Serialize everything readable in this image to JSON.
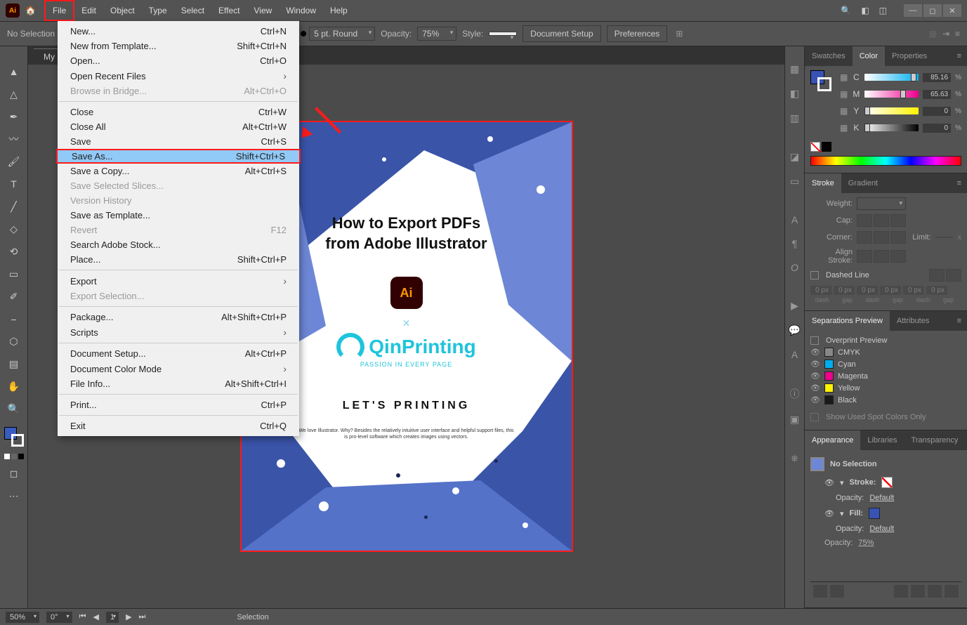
{
  "menubar": [
    "File",
    "Edit",
    "Object",
    "Type",
    "Select",
    "Effect",
    "View",
    "Window",
    "Help"
  ],
  "highlighted_menu_index": 0,
  "controlbar": {
    "selection": "No Selection",
    "stroke_label": "5 pt. Round",
    "opacity_label": "Opacity:",
    "opacity_value": "75%",
    "style_label": "Style:",
    "doc_setup": "Document Setup",
    "prefs": "Preferences"
  },
  "tab": "My bo",
  "dropdown": [
    {
      "label": "New...",
      "shortcut": "Ctrl+N"
    },
    {
      "label": "New from Template...",
      "shortcut": "Shift+Ctrl+N"
    },
    {
      "label": "Open...",
      "shortcut": "Ctrl+O"
    },
    {
      "label": "Open Recent Files",
      "sub": true
    },
    {
      "label": "Browse in Bridge...",
      "shortcut": "Alt+Ctrl+O",
      "disabled": true
    },
    {
      "sep": true
    },
    {
      "label": "Close",
      "shortcut": "Ctrl+W"
    },
    {
      "label": "Close All",
      "shortcut": "Alt+Ctrl+W"
    },
    {
      "label": "Save",
      "shortcut": "Ctrl+S"
    },
    {
      "label": "Save As...",
      "shortcut": "Shift+Ctrl+S",
      "highlight": true
    },
    {
      "label": "Save a Copy...",
      "shortcut": "Alt+Ctrl+S"
    },
    {
      "label": "Save Selected Slices...",
      "disabled": true
    },
    {
      "label": "Version History",
      "disabled": true
    },
    {
      "label": "Save as Template..."
    },
    {
      "label": "Revert",
      "shortcut": "F12",
      "disabled": true
    },
    {
      "label": "Search Adobe Stock..."
    },
    {
      "label": "Place...",
      "shortcut": "Shift+Ctrl+P"
    },
    {
      "sep": true
    },
    {
      "label": "Export",
      "sub": true
    },
    {
      "label": "Export Selection...",
      "disabled": true
    },
    {
      "sep": true
    },
    {
      "label": "Package...",
      "shortcut": "Alt+Shift+Ctrl+P"
    },
    {
      "label": "Scripts",
      "sub": true
    },
    {
      "sep": true
    },
    {
      "label": "Document Setup...",
      "shortcut": "Alt+Ctrl+P"
    },
    {
      "label": "Document Color Mode",
      "sub": true
    },
    {
      "label": "File Info...",
      "shortcut": "Alt+Shift+Ctrl+I"
    },
    {
      "sep": true
    },
    {
      "label": "Print...",
      "shortcut": "Ctrl+P"
    },
    {
      "sep": true
    },
    {
      "label": "Exit",
      "shortcut": "Ctrl+Q"
    }
  ],
  "color_panel": {
    "tabs": [
      "Swatches",
      "Color",
      "Properties"
    ],
    "active": 1,
    "channels": [
      {
        "l": "C",
        "v": "85.16",
        "grad": "linear-gradient(90deg,#fff,#00aeef)",
        "thumb": 85
      },
      {
        "l": "M",
        "v": "65.63",
        "grad": "linear-gradient(90deg,#fff,#ec008c)",
        "thumb": 66
      },
      {
        "l": "Y",
        "v": "0",
        "grad": "linear-gradient(90deg,#fff,#fff200)",
        "thumb": 0
      },
      {
        "l": "K",
        "v": "0",
        "grad": "linear-gradient(90deg,#fff,#000)",
        "thumb": 0
      }
    ]
  },
  "stroke_panel": {
    "tabs": [
      "Stroke",
      "Gradient"
    ],
    "weight": "Weight:",
    "cap": "Cap:",
    "corner": "Corner:",
    "limit": "Limit:",
    "limit_val": "",
    "limit_x": "x",
    "align": "Align Stroke:",
    "dashed": "Dashed Line",
    "dash_labels": [
      "dash",
      "gap",
      "dash",
      "gap",
      "dash",
      "gap"
    ],
    "dash_vals": [
      "0 px",
      "0 px",
      "0 px",
      "0 px",
      "0 px",
      "0 px"
    ]
  },
  "sep_panel": {
    "tabs": [
      "Separations Preview",
      "Attributes"
    ],
    "overprint": "Overprint Preview",
    "rows": [
      {
        "c": "#888",
        "n": "CMYK",
        "icon": true
      },
      {
        "c": "#00aeef",
        "n": "Cyan"
      },
      {
        "c": "#ec008c",
        "n": "Magenta"
      },
      {
        "c": "#fff200",
        "n": "Yellow"
      },
      {
        "c": "#1a1a1a",
        "n": "Black"
      }
    ],
    "show_used": "Show Used Spot Colors Only"
  },
  "appear_panel": {
    "tabs": [
      "Appearance",
      "Libraries",
      "Transparency"
    ],
    "nosel": "No Selection",
    "stroke": "Stroke:",
    "fill": "Fill:",
    "opacity": "Opacity:",
    "op_default": "Default",
    "op_75": "75%"
  },
  "statusbar": {
    "zoom": "50%",
    "rotate": "0°",
    "pager": "1",
    "mode": "Selection"
  },
  "artboard": {
    "h1": "How to Export PDFs",
    "h2": "from Adobe Illustrator",
    "brand": "QinPrinting",
    "tagline": "PASSION IN EVERY PAGE",
    "lets": "LET'S PRINTING",
    "copy": "We love Illustrator. Why? Besides the relatively intuitive user interface and helpful support files, this is pro-level software which creates images using vectors."
  }
}
